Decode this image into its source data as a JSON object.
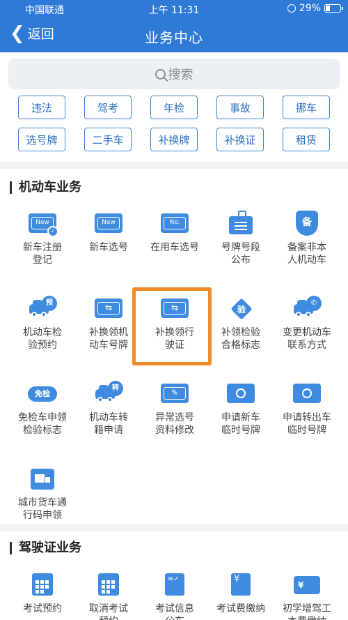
{
  "status": {
    "carrier": "中国联通",
    "time": "上午 11:31",
    "battery": "29%",
    "battery_level": 0.29
  },
  "nav": {
    "back": "返回",
    "title": "业务中心"
  },
  "search": {
    "placeholder": "搜索"
  },
  "tags": [
    "违法",
    "驾考",
    "年检",
    "事故",
    "挪车",
    "选号牌",
    "二手车",
    "补换牌",
    "补换证",
    "租赁"
  ],
  "motor": {
    "title": "机动车业务",
    "items": [
      {
        "line1": "新车注册",
        "line2": "登记",
        "icon": "new-plate-check-icon",
        "badge": "New"
      },
      {
        "line1": "新车选号",
        "line2": "",
        "icon": "new-plate-icon",
        "badge": "New"
      },
      {
        "line1": "在用车选号",
        "line2": "",
        "icon": "plate-number-icon",
        "badge": "No."
      },
      {
        "line1": "号牌号段",
        "line2": "公布",
        "icon": "notice-board-icon"
      },
      {
        "line1": "备案非本",
        "line2": "人机动车",
        "icon": "shield-icon",
        "badge": "备"
      },
      {
        "line1": "机动车检",
        "line2": "验预约",
        "icon": "car-inspect-icon",
        "badge": "预"
      },
      {
        "line1": "补换领机",
        "line2": "动车号牌",
        "icon": "plate-exchange-icon"
      },
      {
        "line1": "补换领行",
        "line2": "驶证",
        "icon": "license-exchange-icon"
      },
      {
        "line1": "补领检验",
        "line2": "合格标志",
        "icon": "inspect-mark-icon",
        "badge": "验"
      },
      {
        "line1": "变更机动车",
        "line2": "联系方式",
        "icon": "car-phone-icon"
      },
      {
        "line1": "免检车申领",
        "line2": "检验标志",
        "icon": "exempt-mark-icon",
        "badge": "免检"
      },
      {
        "line1": "机动车转",
        "line2": "籍申请",
        "icon": "car-transfer-icon",
        "badge": "转"
      },
      {
        "line1": "异常选号",
        "line2": "资料修改",
        "icon": "edit-plate-icon"
      },
      {
        "line1": "申请新车",
        "line2": "临时号牌",
        "icon": "temp-plate-icon"
      },
      {
        "line1": "申请转出车",
        "line2": "临时号牌",
        "icon": "temp-plate-out-icon"
      },
      {
        "line1": "城市货车通",
        "line2": "行码申领",
        "icon": "truck-pass-icon"
      }
    ]
  },
  "license": {
    "title": "驾驶证业务",
    "items": [
      {
        "line1": "考试预约",
        "line2": "",
        "icon": "exam-calendar-icon"
      },
      {
        "line1": "取消考试",
        "line2": "预约",
        "icon": "cancel-calendar-icon"
      },
      {
        "line1": "考试信息",
        "line2": "公布",
        "icon": "exam-info-icon"
      },
      {
        "line1": "考试费缴纳",
        "line2": "",
        "icon": "exam-fee-icon",
        "badge": "¥"
      },
      {
        "line1": "初学增驾工",
        "line2": "本费缴纳",
        "icon": "fee-card-icon",
        "badge": "¥"
      }
    ]
  },
  "colors": {
    "brand": "#2f7ad6",
    "icon": "#3f8be0",
    "highlight": "#f08a2b"
  }
}
